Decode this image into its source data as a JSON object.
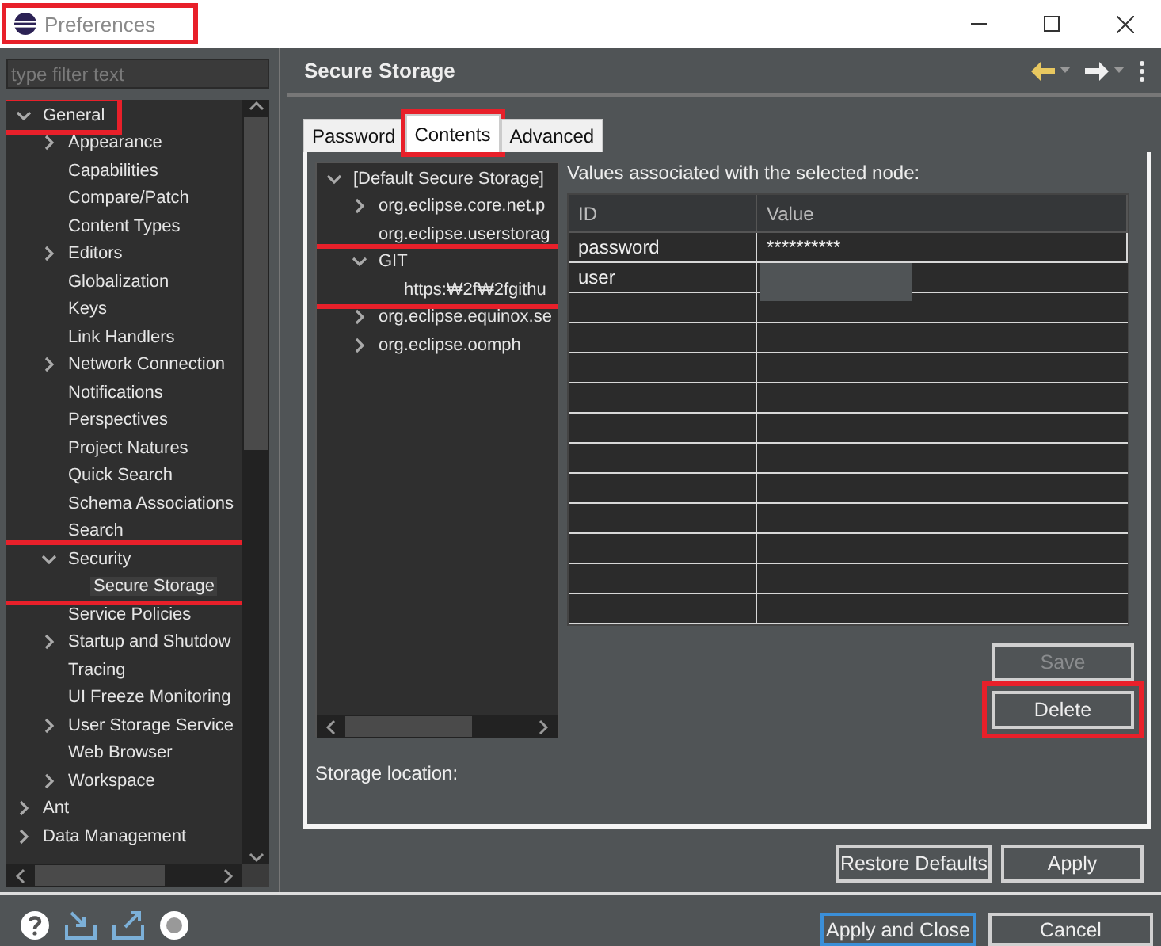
{
  "window": {
    "title": "Preferences",
    "highlighted": true
  },
  "filter": {
    "placeholder": "type filter text"
  },
  "nav_tree": [
    {
      "label": "General",
      "expanded": true,
      "highlighted": true,
      "highlight_covers_children": false,
      "children": [
        {
          "label": "Appearance",
          "expandable": true
        },
        {
          "label": "Capabilities"
        },
        {
          "label": "Compare/Patch"
        },
        {
          "label": "Content Types"
        },
        {
          "label": "Editors",
          "expandable": true
        },
        {
          "label": "Globalization"
        },
        {
          "label": "Keys"
        },
        {
          "label": "Link Handlers"
        },
        {
          "label": "Network Connection",
          "expandable": true
        },
        {
          "label": "Notifications"
        },
        {
          "label": "Perspectives"
        },
        {
          "label": "Project Natures"
        },
        {
          "label": "Quick Search"
        },
        {
          "label": "Schema Associations"
        },
        {
          "label": "Search"
        },
        {
          "label": "Security",
          "expanded": true,
          "highlighted": true,
          "highlight_covers_children": true,
          "children": [
            {
              "label": "Secure Storage",
              "selected": true
            }
          ]
        },
        {
          "label": "Service Policies"
        },
        {
          "label": "Startup and Shutdow",
          "expandable": true
        },
        {
          "label": "Tracing"
        },
        {
          "label": "UI Freeze Monitoring"
        },
        {
          "label": "User Storage Service",
          "expandable": true
        },
        {
          "label": "Web Browser"
        },
        {
          "label": "Workspace",
          "expandable": true
        }
      ]
    },
    {
      "label": "Ant",
      "expandable": true
    },
    {
      "label": "Data Management",
      "expandable": true
    }
  ],
  "page": {
    "title": "Secure Storage"
  },
  "tabs": [
    {
      "label": "Password",
      "selected": false,
      "highlighted": false
    },
    {
      "label": "Contents",
      "selected": true,
      "highlighted": true
    },
    {
      "label": "Advanced",
      "selected": false,
      "highlighted": false
    }
  ],
  "storage_tree": [
    {
      "label": "[Default Secure Storage]",
      "expanded": true,
      "children": [
        {
          "label": "org.eclipse.core.net.p",
          "expandable": true
        },
        {
          "label": "org.eclipse.userstorag"
        },
        {
          "label": "GIT",
          "expanded": true,
          "highlighted": true,
          "highlight_covers_children": true,
          "children": [
            {
              "label": "https:₩2f₩2fgithu"
            }
          ]
        },
        {
          "label": "org.eclipse.equinox.se",
          "expandable": true
        },
        {
          "label": "org.eclipse.oomph",
          "expandable": true
        }
      ]
    }
  ],
  "values": {
    "caption": "Values associated with the selected node:",
    "columns": [
      "ID",
      "Value"
    ],
    "rows": [
      {
        "id": "password",
        "value": "**********",
        "redacted": false
      },
      {
        "id": "user",
        "redacted": true
      }
    ]
  },
  "side_buttons": [
    {
      "label": "Save",
      "disabled": true,
      "highlighted": false
    },
    {
      "label": "Delete",
      "disabled": false,
      "highlighted": true
    }
  ],
  "storage_location": "Storage location:",
  "page_buttons": [
    "Restore Defaults",
    "Apply"
  ],
  "dialog_buttons": [
    {
      "label": "Apply and Close",
      "default": true
    },
    {
      "label": "Cancel",
      "default": false
    }
  ]
}
